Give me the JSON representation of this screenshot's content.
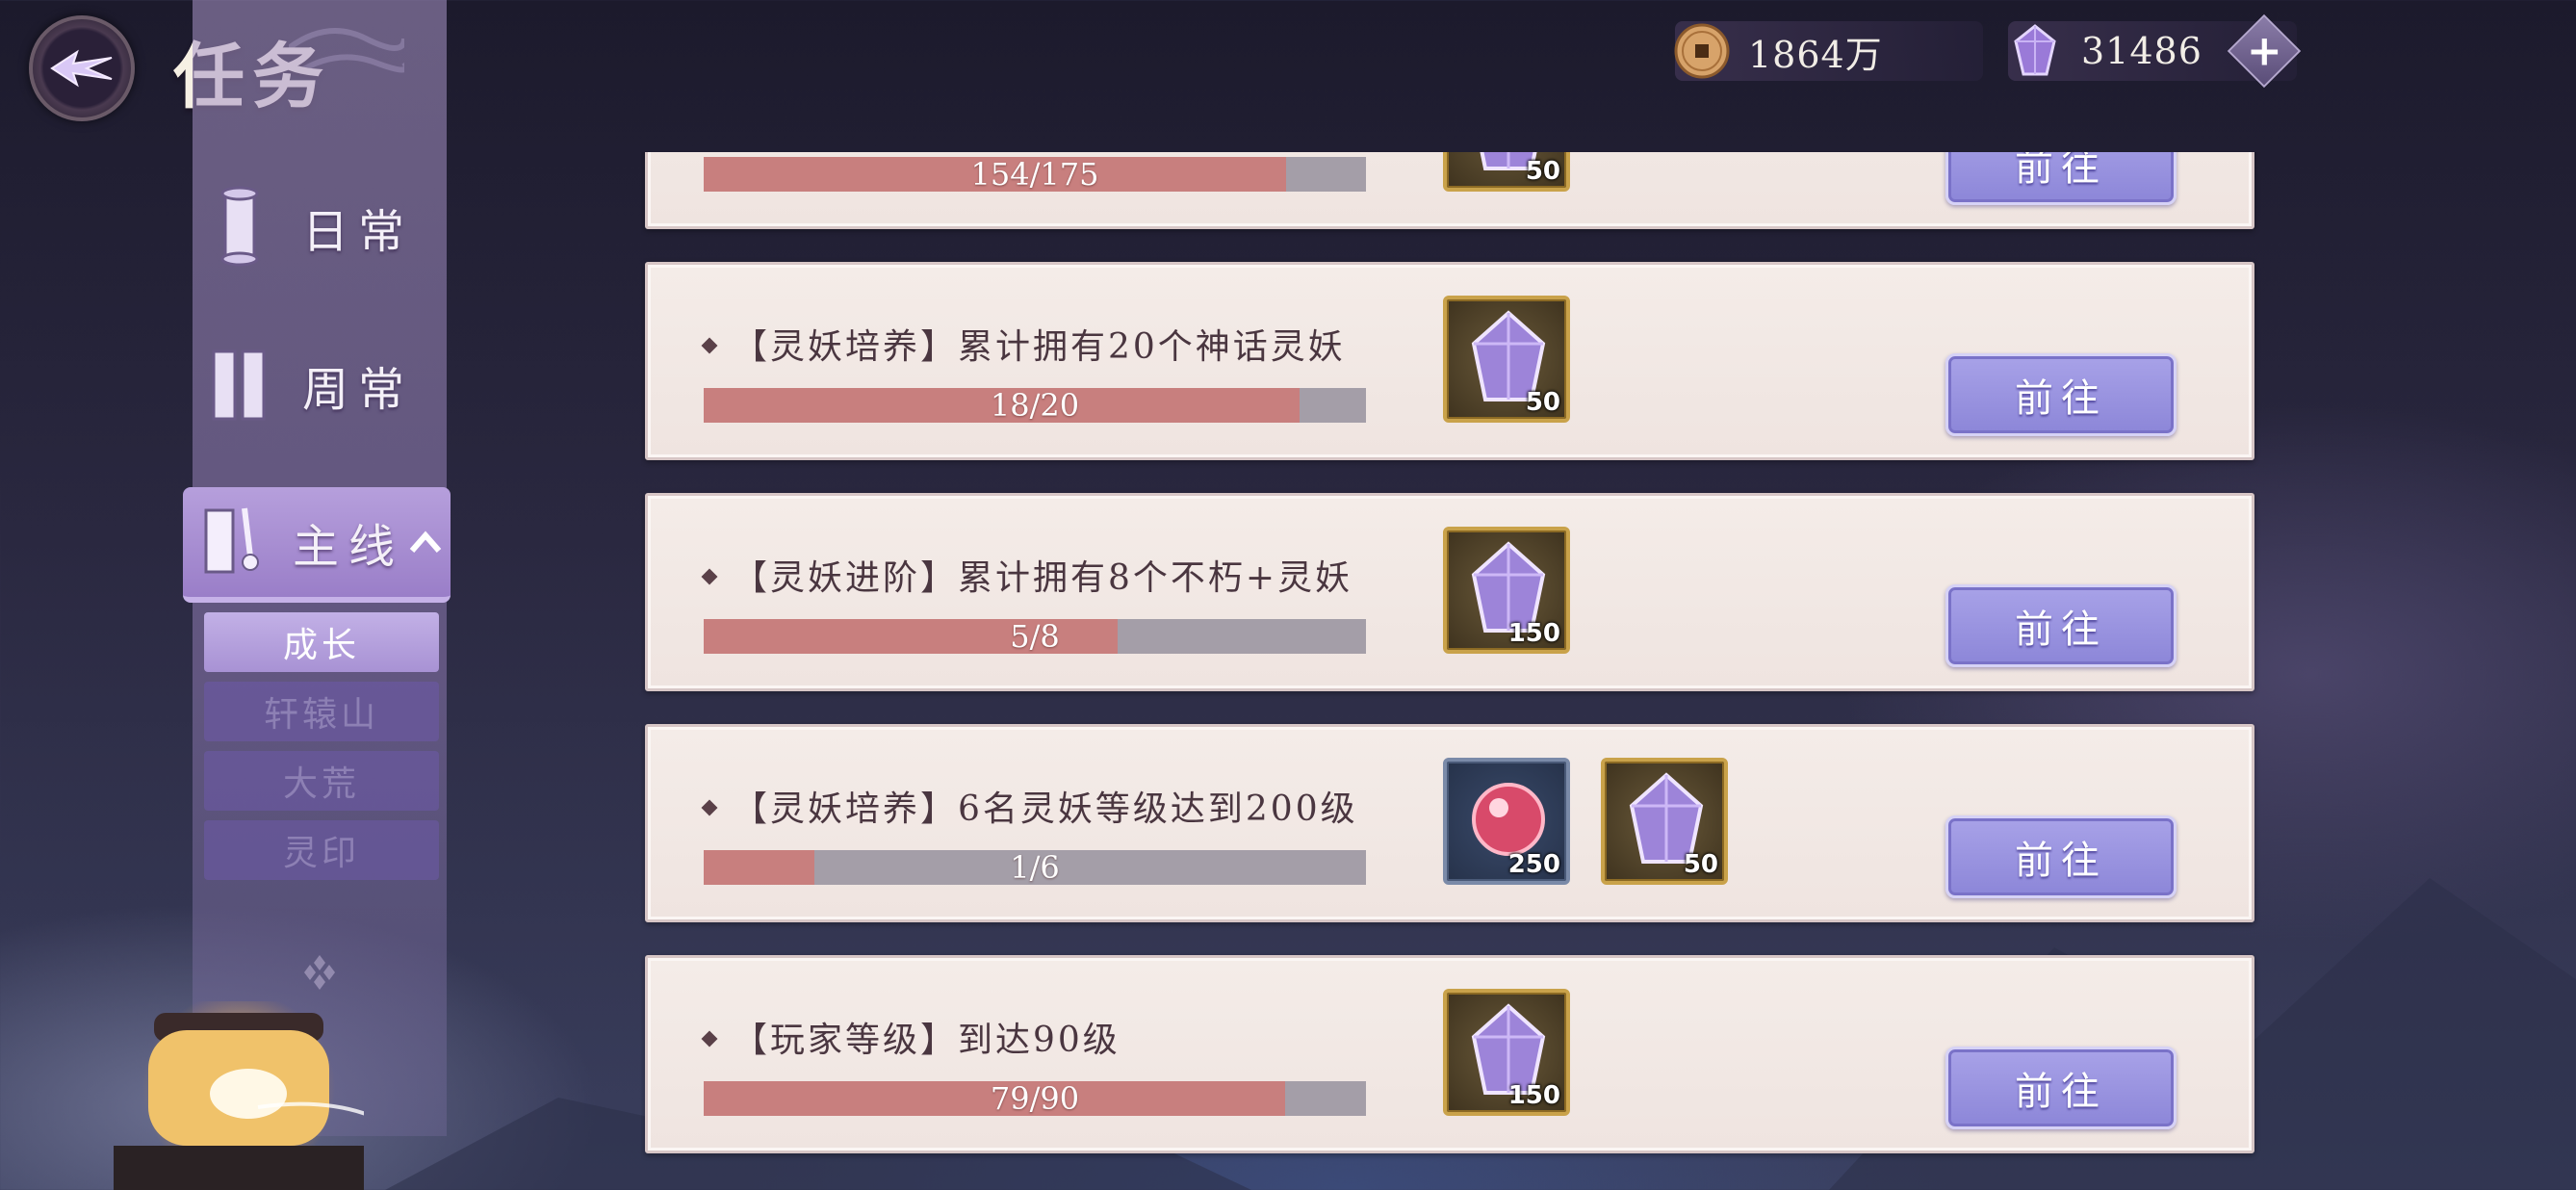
{
  "header": {
    "title": "任务",
    "coins": "1864万",
    "gems": "31486",
    "plus_label": "+"
  },
  "sidebar": {
    "items": [
      {
        "label": "日常"
      },
      {
        "label": "周常"
      },
      {
        "label": "主线"
      }
    ],
    "sub_items": [
      {
        "label": "成长"
      },
      {
        "label": "轩辕山"
      },
      {
        "label": "大荒"
      },
      {
        "label": "灵印"
      }
    ]
  },
  "tasks": [
    {
      "title": "",
      "progress_text": "154/175",
      "progress": 0.88,
      "go_label": "前往",
      "rewards": [
        {
          "icon": "purple-crystal-icon",
          "qty": "50"
        }
      ]
    },
    {
      "title": "【灵妖培养】累计拥有20个神话灵妖",
      "progress_text": "18/20",
      "progress": 0.9,
      "go_label": "前往",
      "rewards": [
        {
          "icon": "purple-crystal-icon",
          "qty": "50"
        }
      ]
    },
    {
      "title": "【灵妖进阶】累计拥有8个不朽+灵妖",
      "progress_text": "5/8",
      "progress": 0.625,
      "go_label": "前往",
      "rewards": [
        {
          "icon": "purple-crystal-icon",
          "qty": "150"
        }
      ]
    },
    {
      "title": "【灵妖培养】6名灵妖等级达到200级",
      "progress_text": "1/6",
      "progress": 0.167,
      "go_label": "前往",
      "rewards": [
        {
          "icon": "red-orb-icon",
          "qty": "250"
        },
        {
          "icon": "purple-crystal-icon",
          "qty": "50"
        }
      ]
    },
    {
      "title": "【玩家等级】到达90级",
      "progress_text": "79/90",
      "progress": 0.878,
      "go_label": "前往",
      "rewards": [
        {
          "icon": "purple-crystal-icon",
          "qty": "150"
        }
      ]
    }
  ],
  "colors": {
    "progress_fill": "#c87f7e",
    "progress_track": "#a49ea8",
    "go_button": "#9a94e0",
    "card_bg": "#f2e8e4"
  }
}
